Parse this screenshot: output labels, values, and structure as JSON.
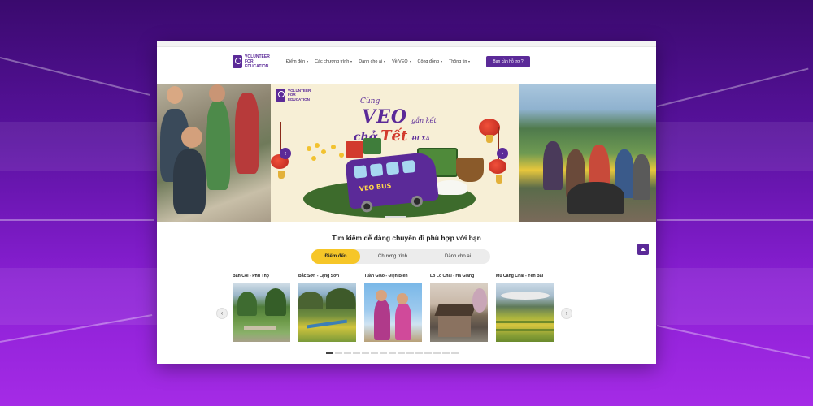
{
  "brand": {
    "name_lines": [
      "VOLUNTEER",
      "FOR",
      "EDUCATION"
    ]
  },
  "nav": {
    "items": [
      {
        "label": "Điểm đến"
      },
      {
        "label": "Các chương trình"
      },
      {
        "label": "Dành cho ai"
      },
      {
        "label": "Về VEO"
      },
      {
        "label": "Cộng đồng"
      },
      {
        "label": "Thông tin"
      }
    ],
    "help_button": "Bạn cần hỗ trợ ?"
  },
  "banner": {
    "logo_lines": [
      "VOLUNTEER",
      "FOR",
      "EDUCATION"
    ],
    "headline": {
      "line1": "Cùng",
      "veo": "VEO",
      "line2": "gắn kết",
      "line3": "chở",
      "tet": "Tết",
      "dixa": "ĐI XA"
    },
    "bus_label": "VEO BUS"
  },
  "search": {
    "title": "Tìm kiếm dễ dàng chuyến đi phù hợp với bạn",
    "tabs": [
      {
        "label": "Điểm đến",
        "active": true
      },
      {
        "label": "Chương trình",
        "active": false
      },
      {
        "label": "Dành cho ai",
        "active": false
      }
    ]
  },
  "destinations": [
    {
      "label": "Bản Cỏi - Phú Thọ"
    },
    {
      "label": "Bắc Sơn - Lạng Sơn"
    },
    {
      "label": "Tuần Giáo - Điện Biên"
    },
    {
      "label": "Lô Lô Chải - Hà Giang"
    },
    {
      "label": "Mù Cang Chải - Yên Bái"
    }
  ],
  "icons": {
    "prev": "chevron-left-icon",
    "next": "chevron-right-icon",
    "scroll_top": "arrow-up-icon"
  },
  "colors": {
    "brand": "#5b2a98",
    "accent": "#f6c628",
    "tet_red": "#d23b2d"
  },
  "carousel": {
    "current_page": 1,
    "total_pages": 15
  }
}
